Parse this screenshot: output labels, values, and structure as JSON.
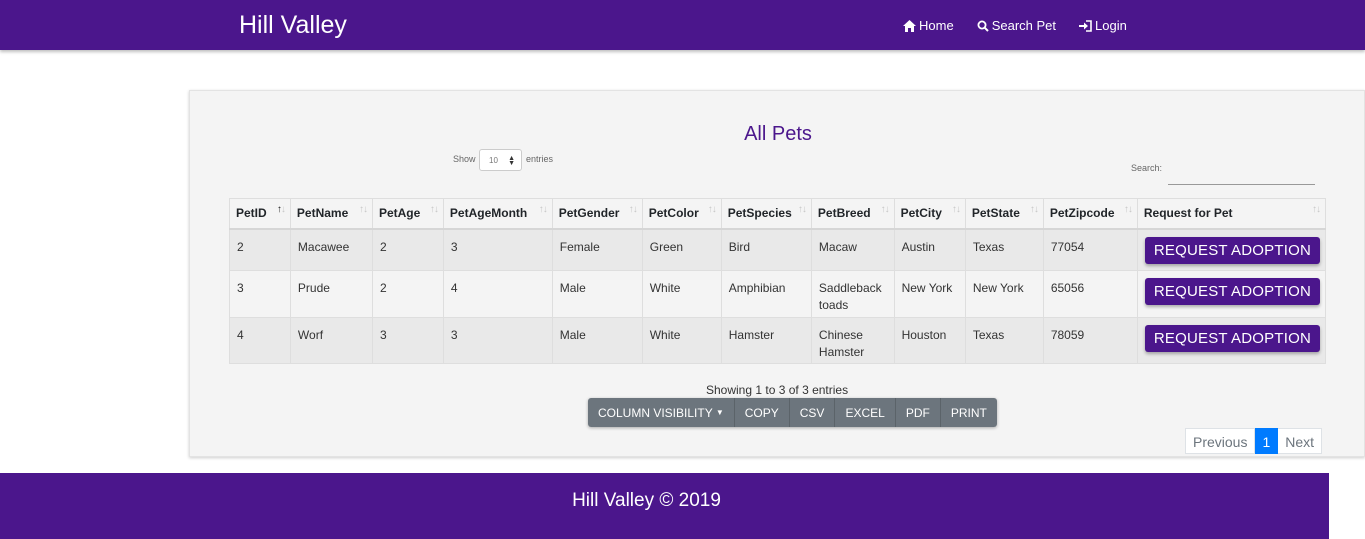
{
  "navbar": {
    "brand": "Hill Valley",
    "links": [
      {
        "label": "Home",
        "icon": "home-icon"
      },
      {
        "label": "Search Pet",
        "icon": "search-icon"
      },
      {
        "label": "Login",
        "icon": "login-icon"
      }
    ],
    "color": "#4b168c"
  },
  "page": {
    "title": "All Pets"
  },
  "length_control": {
    "show_label": "Show",
    "value": "10",
    "entries_label": "entries"
  },
  "search": {
    "label": "Search:",
    "value": ""
  },
  "table": {
    "headers": [
      "PetID",
      "PetName",
      "PetAge",
      "PetAgeMonth",
      "PetGender",
      "PetColor",
      "PetSpecies",
      "PetBreed",
      "PetCity",
      "PetState",
      "PetZipcode",
      "Request for Pet"
    ],
    "rows": [
      {
        "id": "2",
        "name": "Macawee",
        "age": "2",
        "age_month": "3",
        "gender": "Female",
        "color": "Green",
        "species": "Bird",
        "breed": "Macaw",
        "city": "Austin",
        "state": "Texas",
        "zip": "77054",
        "action": "REQUEST ADOPTION"
      },
      {
        "id": "3",
        "name": "Prude",
        "age": "2",
        "age_month": "4",
        "gender": "Male",
        "color": "White",
        "species": "Amphibian",
        "breed": "Saddleback toads",
        "city": "New York",
        "state": "New York",
        "zip": "65056",
        "action": "REQUEST ADOPTION"
      },
      {
        "id": "4",
        "name": "Worf",
        "age": "3",
        "age_month": "3",
        "gender": "Male",
        "color": "White",
        "species": "Hamster",
        "breed": "Chinese Hamster",
        "city": "Houston",
        "state": "Texas",
        "zip": "78059",
        "action": "REQUEST ADOPTION"
      }
    ]
  },
  "info": "Showing 1 to 3 of 3 entries",
  "export_buttons": [
    "COLUMN VISIBILITY",
    "COPY",
    "CSV",
    "EXCEL",
    "PDF",
    "PRINT"
  ],
  "pagination": {
    "previous": "Previous",
    "current": "1",
    "next": "Next"
  },
  "footer": {
    "text": "Hill Valley © 2019"
  }
}
